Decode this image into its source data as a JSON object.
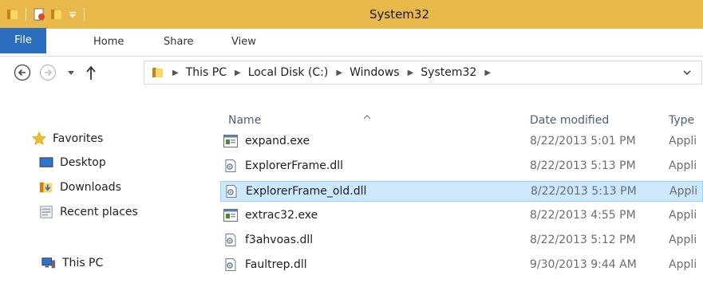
{
  "window": {
    "title": "System32"
  },
  "ribbon": {
    "tabs": [
      "File",
      "Home",
      "Share",
      "View"
    ]
  },
  "address": {
    "crumbs": [
      "This PC",
      "Local Disk (C:)",
      "Windows",
      "System32"
    ]
  },
  "nav": {
    "favorites": "Favorites",
    "items": [
      "Desktop",
      "Downloads",
      "Recent places"
    ],
    "this_pc": "This PC"
  },
  "list": {
    "columns": {
      "name": "Name",
      "date": "Date modified",
      "type": "Type"
    },
    "rows": [
      {
        "name": "expand.exe",
        "date": "8/22/2013 5:01 PM",
        "type": "Appli",
        "icon": "exe-icon",
        "selected": false
      },
      {
        "name": "ExplorerFrame.dll",
        "date": "8/22/2013 5:13 PM",
        "type": "Appli",
        "icon": "dll-icon",
        "selected": false
      },
      {
        "name": "ExplorerFrame_old.dll",
        "date": "8/22/2013 5:13 PM",
        "type": "Appli",
        "icon": "dll-icon",
        "selected": true
      },
      {
        "name": "extrac32.exe",
        "date": "8/22/2013 4:55 PM",
        "type": "Appli",
        "icon": "exe-icon",
        "selected": false
      },
      {
        "name": "f3ahvoas.dll",
        "date": "8/22/2013 5:12 PM",
        "type": "Appli",
        "icon": "dll-icon",
        "selected": false
      },
      {
        "name": "Faultrep.dll",
        "date": "9/30/2013 9:44 AM",
        "type": "Appli",
        "icon": "dll-icon",
        "selected": false
      }
    ]
  },
  "colors": {
    "titlebar": "#e8b84a",
    "file_tab": "#2b6ec0",
    "selection": "#cce8ff"
  }
}
